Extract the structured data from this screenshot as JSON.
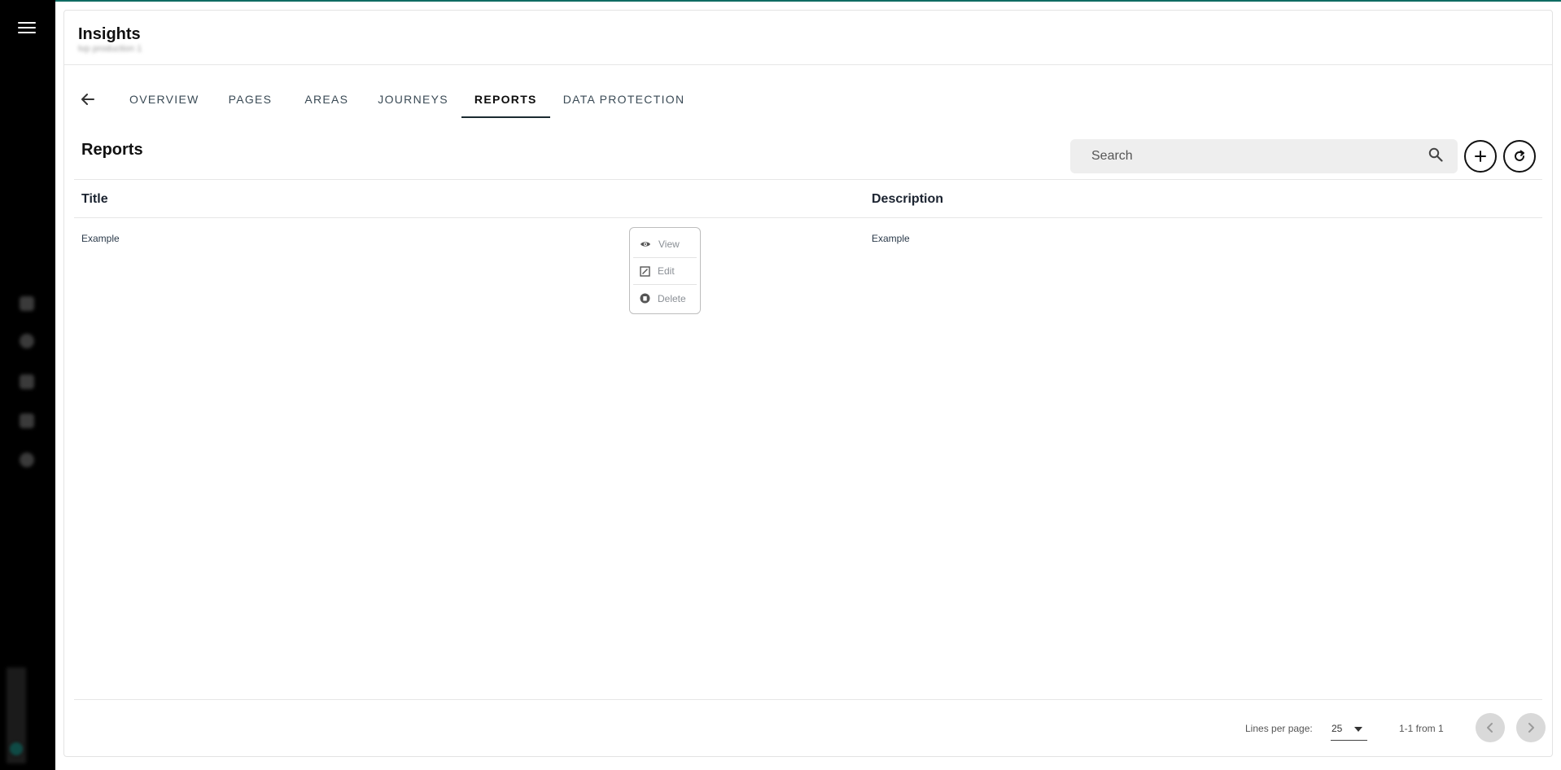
{
  "app": {
    "title": "Insights",
    "subtitle": "tvp production 1"
  },
  "nav": {
    "back_icon": "arrow-left-icon",
    "tabs": [
      {
        "label": "OVERVIEW",
        "active": false
      },
      {
        "label": "PAGES",
        "active": false
      },
      {
        "label": "AREAS",
        "active": false
      },
      {
        "label": "JOURNEYS",
        "active": false
      },
      {
        "label": "REPORTS",
        "active": true
      },
      {
        "label": "DATA PROTECTION",
        "active": false
      }
    ]
  },
  "reports": {
    "title": "Reports",
    "search": {
      "placeholder": "Search",
      "value": ""
    },
    "add_icon": "plus-icon",
    "refresh_icon": "refresh-icon",
    "columns": {
      "title": "Title",
      "description": "Description"
    },
    "rows": [
      {
        "title": "Example",
        "description": "Example"
      }
    ]
  },
  "context_menu": {
    "items": [
      {
        "label": "View",
        "icon": "eye-icon"
      },
      {
        "label": "Edit",
        "icon": "edit-icon"
      },
      {
        "label": "Delete",
        "icon": "delete-icon"
      }
    ]
  },
  "pagination": {
    "lines_per_page_label": "Lines per page:",
    "lines_per_page_value": "25",
    "range_text": "1-1 from 1"
  },
  "colors": {
    "accent": "#0f6b63",
    "rail": "#000000",
    "search_bg": "#eeeeee",
    "active_tab_underline": "#1b2a30"
  }
}
